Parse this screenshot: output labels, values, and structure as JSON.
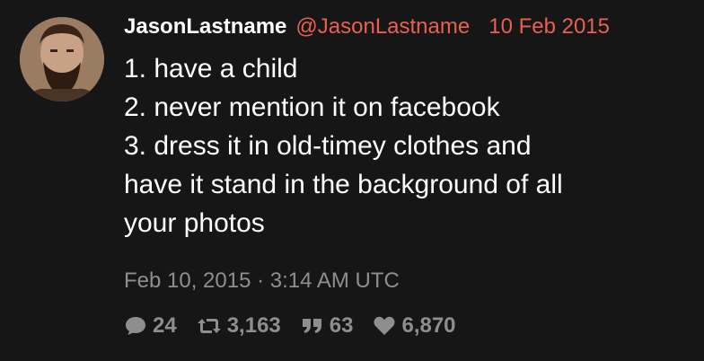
{
  "author": {
    "display_name": "JasonLastname",
    "username": "@JasonLastname",
    "date": "10 Feb 2015",
    "avatar_icon": "avatar-photo"
  },
  "tweet": {
    "lines": [
      "1. have a child",
      "2. never mention it on facebook",
      "3. dress it in old-timey clothes and",
      "have it stand in the background of all",
      "your photos"
    ],
    "timestamp": "Feb 10, 2015 · 3:14 AM UTC"
  },
  "stats": {
    "replies": "24",
    "retweets": "3,163",
    "quotes": "63",
    "likes": "6,870"
  },
  "colors": {
    "background": "#161616",
    "accent": "#e8604f",
    "muted": "#8e8e8e",
    "text": "#ffffff"
  }
}
